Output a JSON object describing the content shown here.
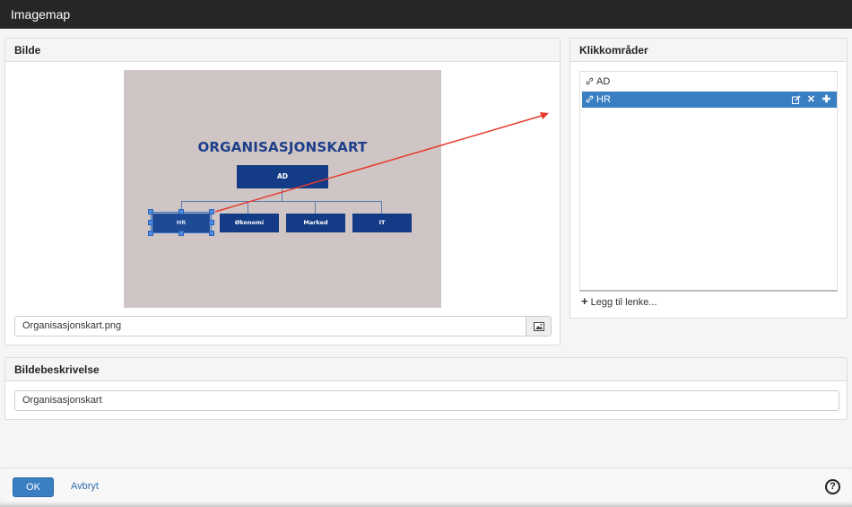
{
  "window": {
    "title": "Imagemap"
  },
  "image_panel": {
    "heading": "Bilde",
    "file_name": "Organisasjonskart.png",
    "browse_icon": "image-icon",
    "image": {
      "title": "ORGANISASJONSKART",
      "boxes": {
        "top": "AD",
        "b1": "HR",
        "b2": "Økonomi",
        "b3": "Marked",
        "b4": "IT"
      },
      "background": "#cfc5c5",
      "box_color": "#133b86"
    }
  },
  "areas_panel": {
    "heading": "Klikkområder",
    "items": [
      {
        "label": "AD",
        "selected": false
      },
      {
        "label": "HR",
        "selected": true
      }
    ],
    "item_actions": [
      "edit-icon",
      "delete-icon",
      "move-icon"
    ],
    "add_link": "Legg til lenke..."
  },
  "description_panel": {
    "heading": "Bildebeskrivelse",
    "value": "Organisasjonskart"
  },
  "footer": {
    "ok": "OK",
    "cancel": "Avbryt",
    "help": "?"
  },
  "colors": {
    "accent": "#3a7fc1",
    "arrow": "#e63b2e",
    "titlebar": "#262626"
  }
}
